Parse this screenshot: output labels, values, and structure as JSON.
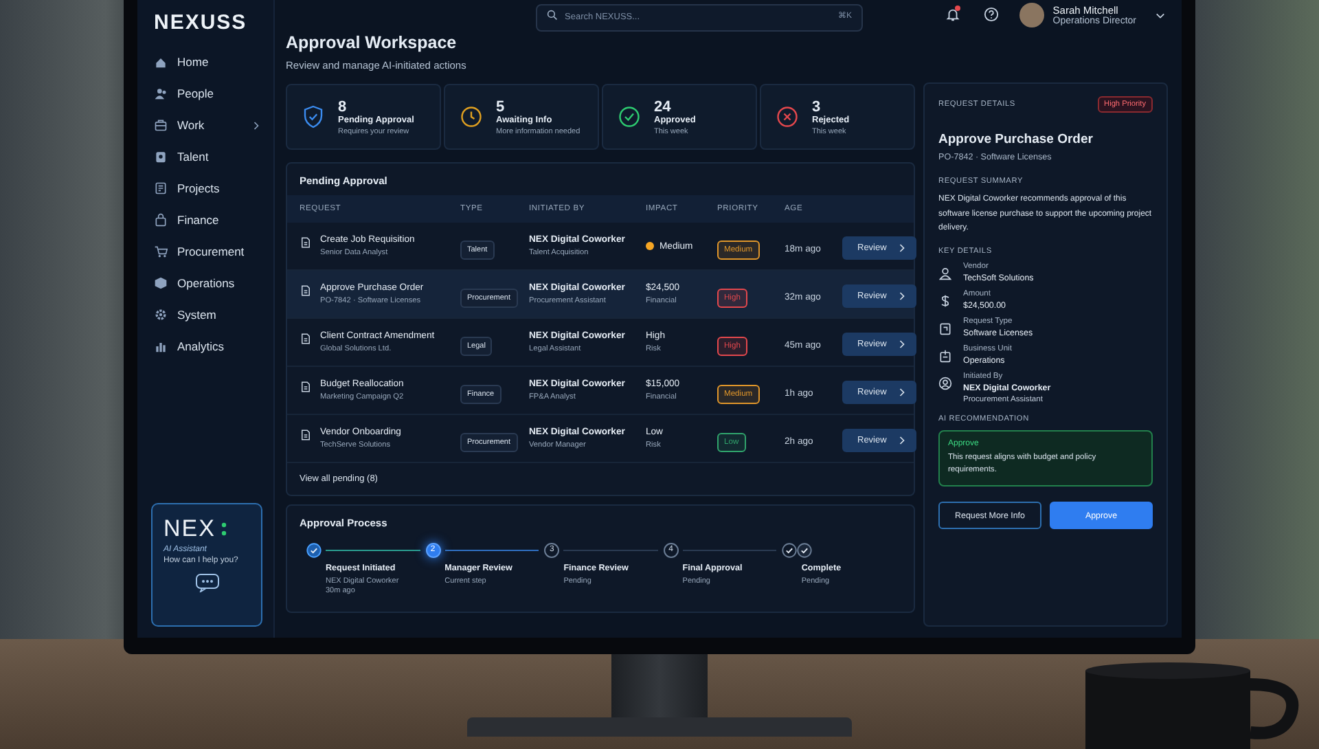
{
  "brand": "NEXUSS",
  "nav": [
    {
      "label": "Home",
      "expandable": false
    },
    {
      "label": "People",
      "expandable": false
    },
    {
      "label": "Work",
      "expandable": true
    },
    {
      "label": "Talent",
      "expandable": false
    },
    {
      "label": "Projects",
      "expandable": false
    },
    {
      "label": "Finance",
      "expandable": false
    },
    {
      "label": "Procurement",
      "expandable": false
    },
    {
      "label": "Operations",
      "expandable": false
    },
    {
      "label": "System",
      "expandable": false
    },
    {
      "label": "Analytics",
      "expandable": false
    }
  ],
  "assistant": {
    "title": "NEX",
    "subtitle": "AI Assistant",
    "prompt": "How can I help you?"
  },
  "topbar": {
    "search": {
      "placeholder": "Search NEXUSS...",
      "shortcut": "⌘K"
    },
    "notifications": {
      "unread": true
    },
    "user": {
      "name": "Sarah Mitchell",
      "role": "Operations Director"
    }
  },
  "page": {
    "title": "Approval Workspace",
    "subtitle": "Review and manage AI-initiated actions"
  },
  "stats": [
    {
      "kind": "pending",
      "value": "8",
      "label": "Pending Approval",
      "note": "Requires your review"
    },
    {
      "kind": "awaiting",
      "value": "5",
      "label": "Awaiting Info",
      "note": "More information needed"
    },
    {
      "kind": "approved",
      "value": "24",
      "label": "Approved",
      "note": "This week"
    },
    {
      "kind": "rejected",
      "value": "3",
      "label": "Rejected",
      "note": "This week"
    }
  ],
  "pending": {
    "title": "Pending Approval",
    "columns": [
      "REQUEST",
      "TYPE",
      "INITIATED BY",
      "IMPACT",
      "PRIORITY",
      "AGE"
    ],
    "rows": [
      {
        "title": "Create Job Requisition",
        "subtitle": "Senior Data Analyst",
        "type": "Talent",
        "initiator": "NEX Digital Coworker",
        "initiator_role": "Talent Acquisition",
        "impact": {
          "kind": "dot",
          "text": "Medium",
          "color": "#f5a524"
        },
        "priority": {
          "text": "Medium",
          "color": "#e0962a"
        },
        "age": "18m ago",
        "action": "Review",
        "selected": false
      },
      {
        "title": "Approve Purchase Order",
        "subtitle": "PO-7842 · Software Licenses",
        "type": "Procurement",
        "initiator": "NEX Digital Coworker",
        "initiator_role": "Procurement Assistant",
        "impact": {
          "kind": "stacked",
          "text": "$24,500",
          "note": "Financial"
        },
        "priority": {
          "text": "High",
          "color": "#e5484d"
        },
        "age": "32m ago",
        "action": "Review",
        "selected": true
      },
      {
        "title": "Client Contract Amendment",
        "subtitle": "Global Solutions Ltd.",
        "type": "Legal",
        "initiator": "NEX Digital Coworker",
        "initiator_role": "Legal Assistant",
        "impact": {
          "kind": "stacked",
          "text": "High",
          "note": "Risk"
        },
        "priority": {
          "text": "High",
          "color": "#e5484d"
        },
        "age": "45m ago",
        "action": "Review",
        "selected": false
      },
      {
        "title": "Budget Reallocation",
        "subtitle": "Marketing Campaign Q2",
        "type": "Finance",
        "initiator": "NEX Digital Coworker",
        "initiator_role": "FP&A Analyst",
        "impact": {
          "kind": "stacked",
          "text": "$15,000",
          "note": "Financial"
        },
        "priority": {
          "text": "Medium",
          "color": "#e0962a"
        },
        "age": "1h ago",
        "action": "Review",
        "selected": false
      },
      {
        "title": "Vendor Onboarding",
        "subtitle": "TechServe Solutions",
        "type": "Procurement",
        "initiator": "NEX Digital Coworker",
        "initiator_role": "Vendor Manager",
        "impact": {
          "kind": "stacked",
          "text": "Low",
          "note": "Risk"
        },
        "priority": {
          "text": "Low",
          "color": "#30a46c"
        },
        "age": "2h ago",
        "action": "Review",
        "selected": false
      }
    ],
    "footer_link": "View all pending (8)"
  },
  "process": {
    "title": "Approval Process",
    "steps": [
      {
        "completed": true,
        "current": false,
        "title": "Request Initiated",
        "notes": [
          "NEX Digital Coworker",
          "30m ago"
        ]
      },
      {
        "completed": false,
        "current": true,
        "marker": "2",
        "title": "Manager Review",
        "notes": [
          "Current step"
        ]
      },
      {
        "completed": false,
        "current": false,
        "marker": "3",
        "title": "Finance Review",
        "notes": [
          "Pending"
        ]
      },
      {
        "completed": false,
        "current": false,
        "marker": "4",
        "title": "Final Approval",
        "notes": [
          "Pending"
        ]
      },
      {
        "completed": false,
        "current": false,
        "title": "Complete",
        "notes": [
          "Pending"
        ]
      }
    ]
  },
  "details": {
    "heading": "REQUEST DETAILS",
    "badge": "High Priority",
    "title": "Approve Purchase Order",
    "subtitle": "PO-7842 · Software Licenses",
    "summary_heading": "REQUEST SUMMARY",
    "summary": "NEX Digital Coworker recommends approval of this software license purchase to support the upcoming project delivery.",
    "key_heading": "KEY DETAILS",
    "fields": [
      {
        "label": "Vendor",
        "value": "TechSoft Solutions"
      },
      {
        "label": "Amount",
        "value": "$24,500.00"
      },
      {
        "label": "Request Type",
        "value": "Software Licenses"
      },
      {
        "label": "Business Unit",
        "value": "Operations"
      },
      {
        "label": "Initiated By",
        "value": "NEX Digital Coworker",
        "extra": "Procurement Assistant"
      }
    ],
    "ai_heading": "AI RECOMMENDATION",
    "recommendation": {
      "verdict": "Approve",
      "text": "This request aligns with budget and policy requirements."
    },
    "buttons": [
      {
        "kind": "secondary",
        "label": "Request More Info"
      },
      {
        "kind": "primary",
        "label": "Approve"
      }
    ]
  }
}
